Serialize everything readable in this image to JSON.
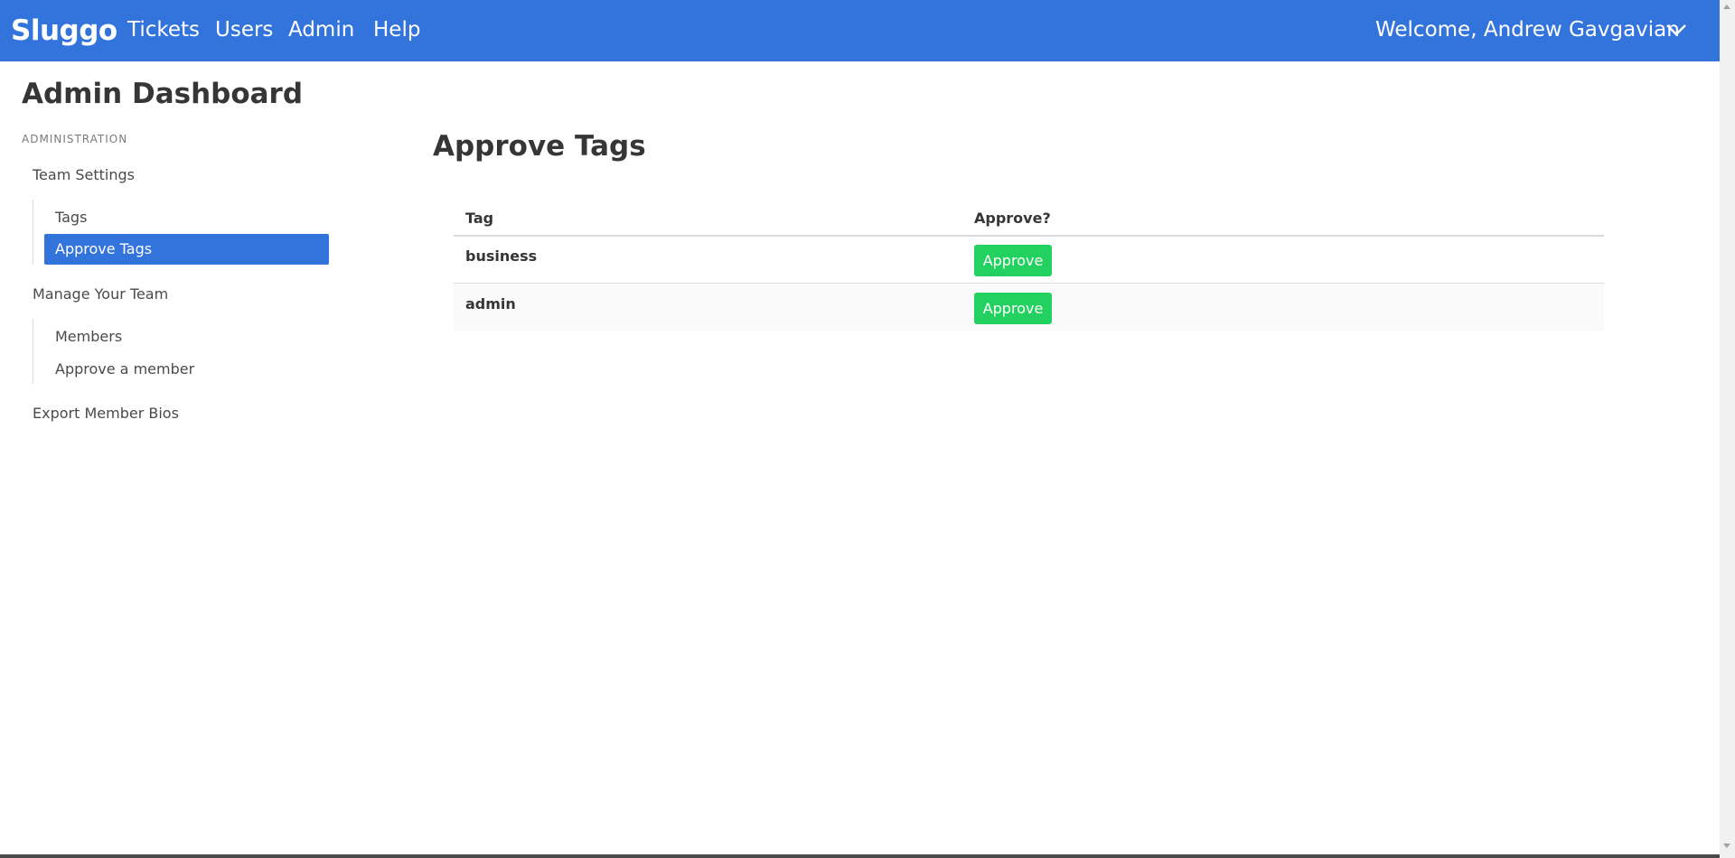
{
  "navbar": {
    "brand": "Sluggo",
    "items": [
      {
        "label": "Tickets"
      },
      {
        "label": "Users"
      },
      {
        "label": "Admin"
      },
      {
        "label": "Help"
      }
    ],
    "welcome": "Welcome, Andrew Gavgavian",
    "color": "#3273dc"
  },
  "sidebar": {
    "title": "Admin Dashboard",
    "section_label": "Administration",
    "team_settings": "Team Settings",
    "team_settings_items": [
      {
        "label": "Tags",
        "active": false
      },
      {
        "label": "Approve Tags",
        "active": true
      }
    ],
    "manage_team": "Manage Your Team",
    "manage_team_items": [
      {
        "label": "Members",
        "active": false
      },
      {
        "label": "Approve a member",
        "active": false
      }
    ],
    "export": "Export Member Bios"
  },
  "main": {
    "title": "Approve Tags",
    "table": {
      "headers": [
        "Tag",
        "Approve?"
      ],
      "rows": [
        {
          "tag": "business",
          "action": "Approve"
        },
        {
          "tag": "admin",
          "action": "Approve"
        }
      ]
    },
    "approve_color": "#23d160"
  }
}
